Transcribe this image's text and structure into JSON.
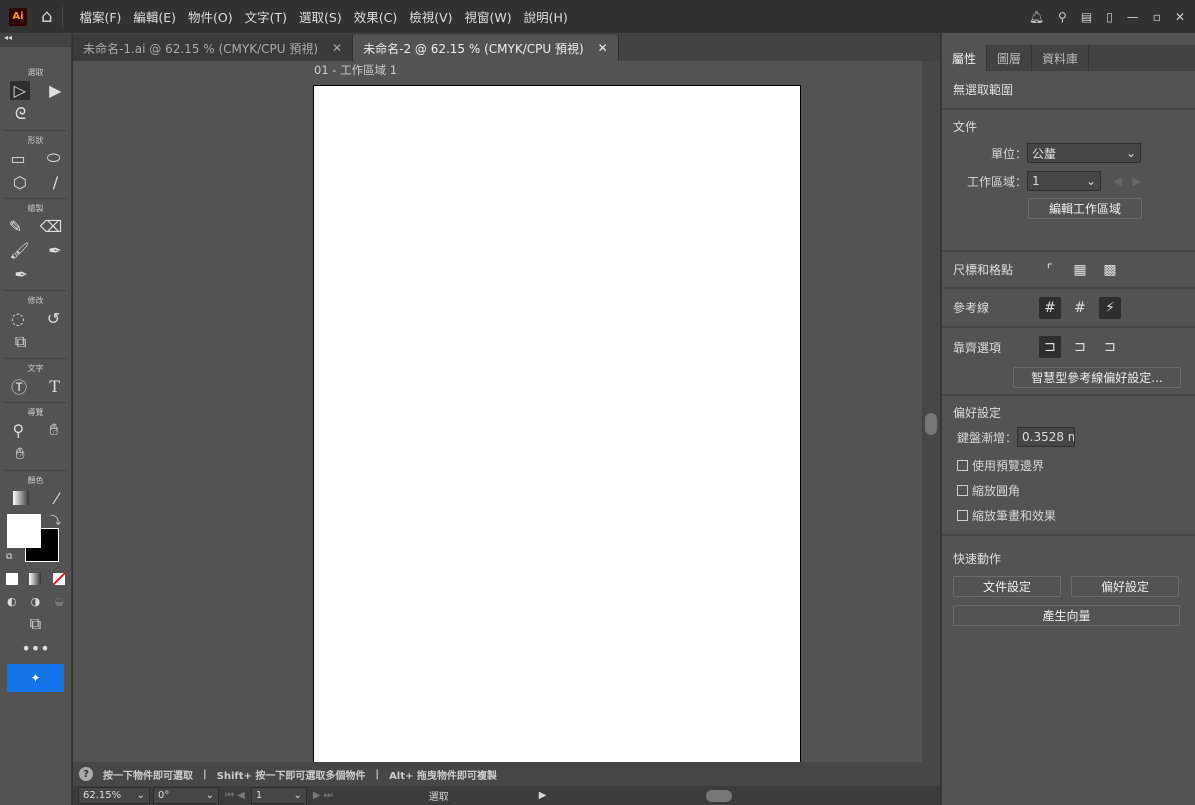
{
  "app": {
    "logo": "Ai",
    "menus": [
      "檔案(F)",
      "編輯(E)",
      "物件(O)",
      "文字(T)",
      "選取(S)",
      "效果(C)",
      "檢視(V)",
      "視窗(W)",
      "說明(H)"
    ]
  },
  "tabs": [
    {
      "label": "未命名-1.ai @ 62.15 % (CMYK/CPU 預視)",
      "active": false
    },
    {
      "label": "未命名-2 @ 62.15 % (CMYK/CPU 預視)",
      "active": true
    }
  ],
  "artboard_label": "01 - 工作區域 1",
  "toolbar": {
    "groups": [
      "選取",
      "形狀",
      "繪製",
      "修改",
      "文字",
      "導覽",
      "顏色"
    ]
  },
  "status": {
    "hints": [
      "按一下物件即可選取",
      "Shift+ 按一下即可選取多個物件",
      "Alt+ 拖曳物件即可複製"
    ],
    "zoom": "62.15%",
    "rotation": "0°",
    "artboard": "1",
    "tool": "選取"
  },
  "panel": {
    "tabs": [
      "屬性",
      "圖層",
      "資料庫"
    ],
    "no_selection": "無選取範圍",
    "document": "文件",
    "units_label": "單位：",
    "units_value": "公釐",
    "artboard_label": "工作區域：",
    "artboard_value": "1",
    "edit_artboards": "編輯工作區域",
    "rulers_grids": "尺標和格點",
    "guides": "參考線",
    "snap_options": "靠齊選項",
    "smart_guides_prefs": "智慧型參考線偏好設定...",
    "preferences": "偏好設定",
    "keyboard_increment_label": "鍵盤漸增：",
    "keyboard_increment_value": "0.3528 m",
    "checkboxes": [
      "使用預覽邊界",
      "縮放圓角",
      "縮放筆畫和效果"
    ],
    "quick_actions": "快速動作",
    "doc_setup": "文件設定",
    "prefs_btn": "偏好設定",
    "gen_vectors": "產生向量"
  }
}
